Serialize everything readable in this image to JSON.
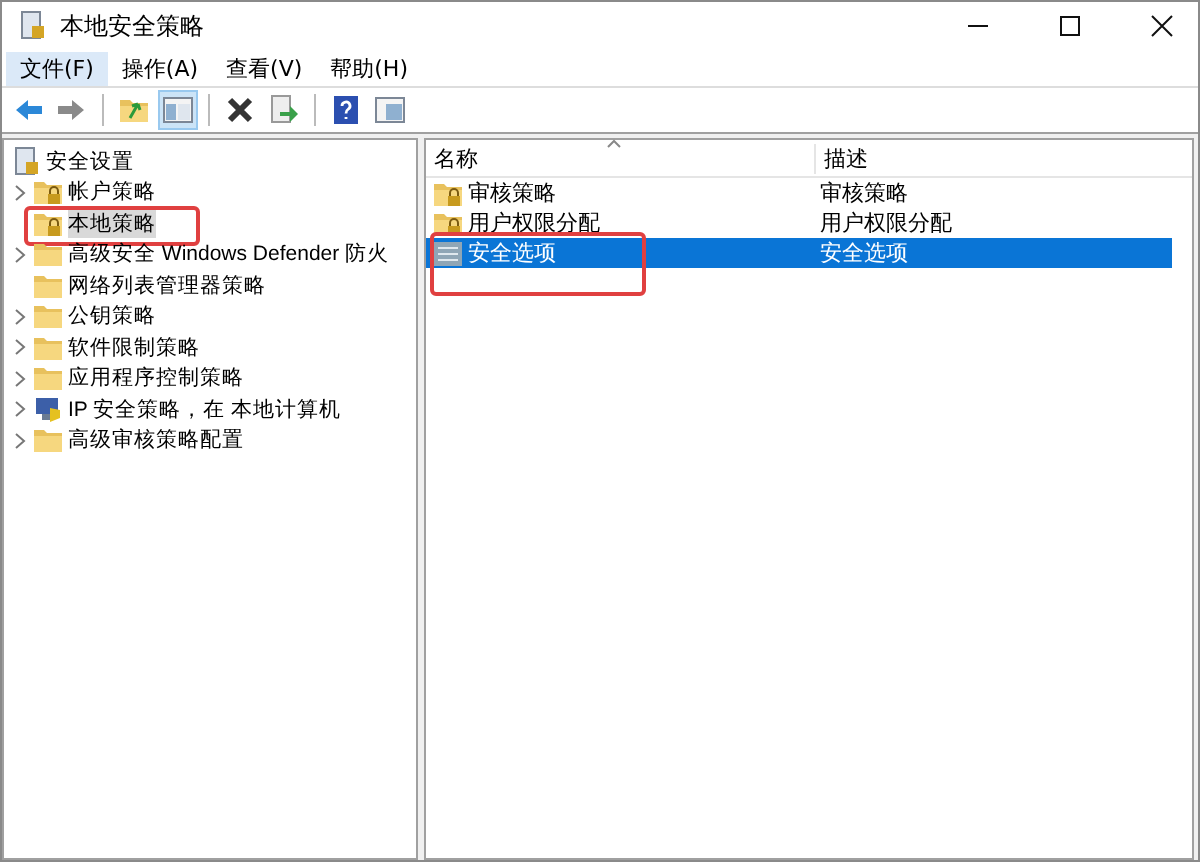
{
  "window": {
    "title": "本地安全策略"
  },
  "menu": [
    {
      "label": "文件(F)",
      "selected": true
    },
    {
      "label": "操作(A)",
      "selected": false
    },
    {
      "label": "查看(V)",
      "selected": false
    },
    {
      "label": "帮助(H)",
      "selected": false
    }
  ],
  "toolbar": [
    {
      "kind": "back",
      "pressed": false
    },
    {
      "kind": "forward",
      "pressed": false
    },
    {
      "kind": "sep"
    },
    {
      "kind": "up",
      "pressed": false
    },
    {
      "kind": "tree",
      "pressed": true
    },
    {
      "kind": "sep"
    },
    {
      "kind": "delete",
      "pressed": false
    },
    {
      "kind": "export",
      "pressed": false
    },
    {
      "kind": "sep"
    },
    {
      "kind": "help",
      "pressed": false
    },
    {
      "kind": "view",
      "pressed": false
    }
  ],
  "tree": {
    "label": "安全设置",
    "kind": "root",
    "children": [
      {
        "label": "帐户策略",
        "kind": "lockfolder",
        "expandable": true,
        "selected": false,
        "annotated": false
      },
      {
        "label": "本地策略",
        "kind": "lockfolder",
        "expandable": false,
        "selected": true,
        "annotated": true
      },
      {
        "label": "高级安全 Windows Defender 防火",
        "kind": "folder",
        "expandable": true,
        "selected": false,
        "annotated": false
      },
      {
        "label": "网络列表管理器策略",
        "kind": "folder",
        "expandable": false,
        "selected": false,
        "annotated": false
      },
      {
        "label": "公钥策略",
        "kind": "folder",
        "expandable": true,
        "selected": false,
        "annotated": false
      },
      {
        "label": "软件限制策略",
        "kind": "folder",
        "expandable": true,
        "selected": false,
        "annotated": false
      },
      {
        "label": "应用程序控制策略",
        "kind": "folder",
        "expandable": true,
        "selected": false,
        "annotated": false
      },
      {
        "label": "IP 安全策略，在 本地计算机",
        "kind": "ipsec",
        "expandable": true,
        "selected": false,
        "annotated": false
      },
      {
        "label": "高级审核策略配置",
        "kind": "folder",
        "expandable": true,
        "selected": false,
        "annotated": false
      }
    ]
  },
  "list": {
    "columns": [
      "名称",
      "描述"
    ],
    "rows": [
      {
        "name": "审核策略",
        "description": "审核策略",
        "kind": "lockfolder",
        "selected": false,
        "annotated": false
      },
      {
        "name": "用户权限分配",
        "description": "用户权限分配",
        "kind": "lockfolder",
        "selected": false,
        "annotated": false
      },
      {
        "name": "安全选项",
        "description": "安全选项",
        "kind": "options",
        "selected": true,
        "annotated": true
      }
    ]
  }
}
